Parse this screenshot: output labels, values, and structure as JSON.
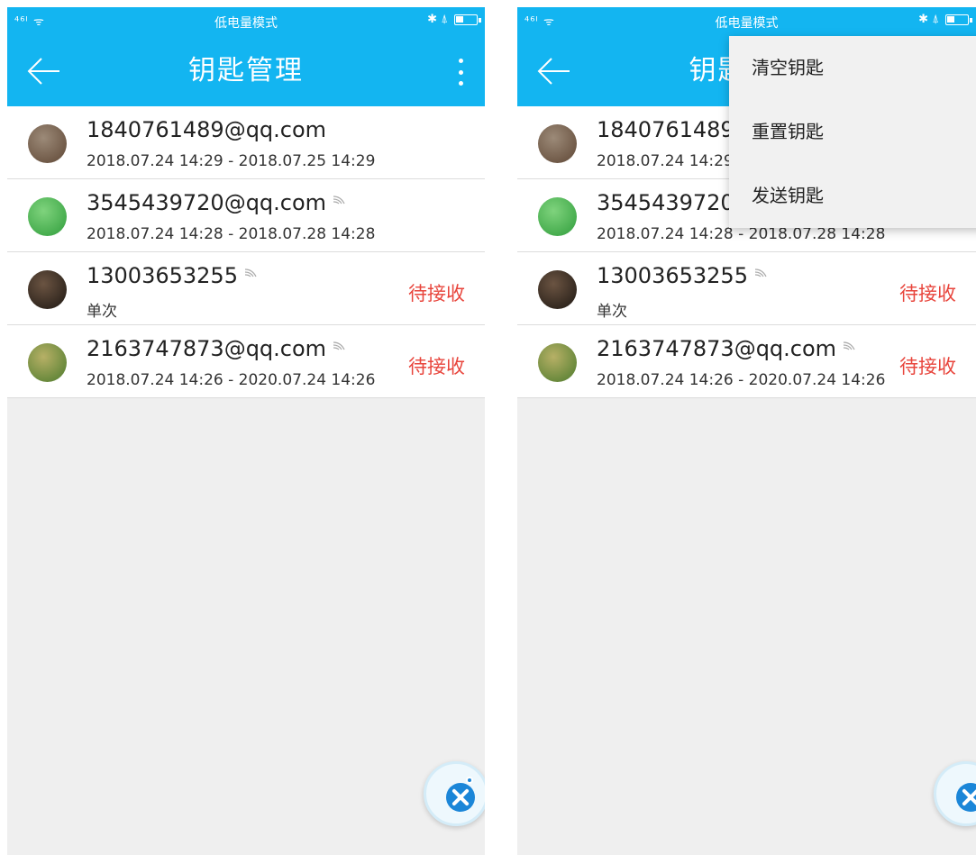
{
  "statusbar": {
    "signal": "⁴⁶ᴵ ᯤ",
    "mode_text": "低电量模式",
    "right_icons": "✱ ⍋"
  },
  "appbar": {
    "title": "钥匙管理"
  },
  "keys": [
    {
      "name": "1840761489@qq.com",
      "detail": "2018.07.24 14:29 - 2018.07.25 14:29",
      "status": "",
      "wifi": false,
      "avatar": [
        "#9c8a78",
        "#5e4634"
      ]
    },
    {
      "name": "3545439720@qq.com",
      "detail": "2018.07.24 14:28 - 2018.07.28 14:28",
      "status": "",
      "wifi": true,
      "avatar": [
        "#7fd37d",
        "#2f9d3b"
      ]
    },
    {
      "name": "13003653255",
      "detail": "单次",
      "status": "待接收",
      "wifi": true,
      "avatar": [
        "#6b5442",
        "#1d1712"
      ]
    },
    {
      "name": "2163747873@qq.com",
      "detail": "2018.07.24 14:26 - 2020.07.24 14:26",
      "status": "待接收",
      "wifi": true,
      "avatar": [
        "#b7b066",
        "#4b7a2c"
      ]
    }
  ],
  "menu": {
    "items": [
      "清空钥匙",
      "重置钥匙",
      "发送钥匙"
    ]
  },
  "colors": {
    "primary": "#13b5f1",
    "status_red": "#e8453c",
    "fab_blue": "#1b86d8"
  },
  "icons": {
    "back": "arrow-left-icon",
    "more": "more-vertical-icon",
    "fab": "key-share-icon"
  }
}
